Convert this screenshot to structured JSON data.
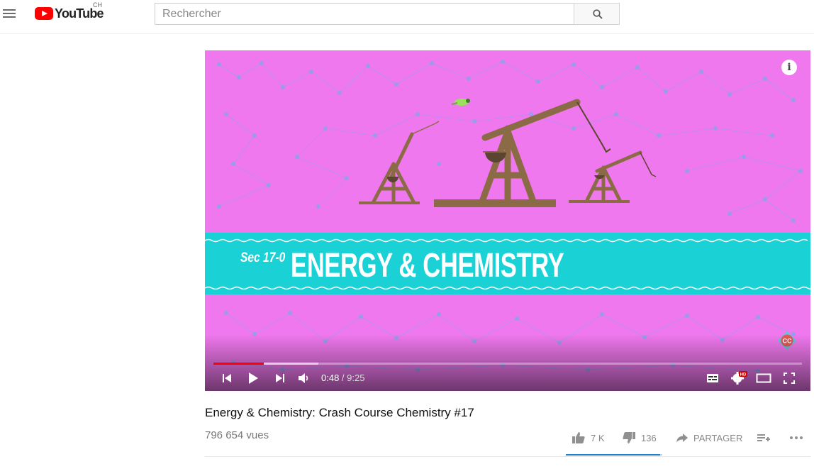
{
  "masthead": {
    "logo_text": "YouTube",
    "country_code": "CH",
    "search_placeholder": "Rechercher"
  },
  "player": {
    "thumbnail_prefix": "Sec 17-0",
    "thumbnail_title": "ENERGY & CHEMISTRY",
    "info_label": "i",
    "current_time": "0:48",
    "separator": " / ",
    "duration": "9:25",
    "played_fraction": 0.085,
    "buffered_fraction": 0.178,
    "icons": {
      "previous": "skip-previous-icon",
      "play": "play-icon",
      "next": "skip-next-icon",
      "volume": "volume-icon",
      "subtitles": "subtitles-icon",
      "settings": "settings-gear-hd-icon",
      "theater": "theater-mode-icon",
      "fullscreen": "fullscreen-icon"
    },
    "colors": {
      "background": "#f078ee",
      "banner": "#1ad1d6",
      "progress": "#ff0000"
    }
  },
  "video": {
    "title": "Energy & Chemistry: Crash Course Chemistry #17",
    "views": "796 654 vues",
    "likes": "7 K",
    "dislikes": "136",
    "share_label": "PARTAGER",
    "like_fraction": 0.98
  }
}
